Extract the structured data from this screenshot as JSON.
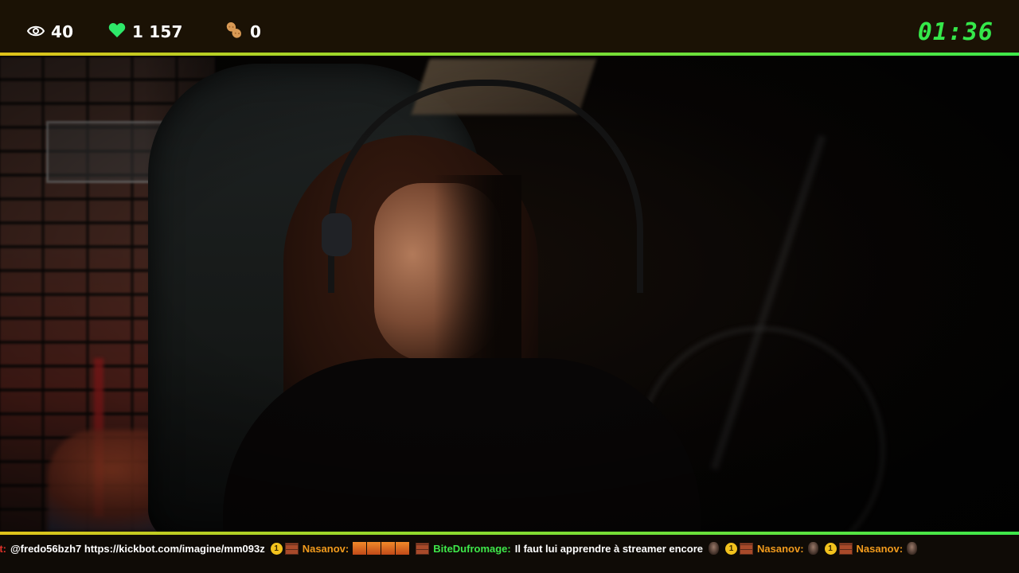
{
  "topbar": {
    "viewers": {
      "icon": "eye-icon",
      "value": "40"
    },
    "likes": {
      "icon": "heart-icon",
      "value": "1 157",
      "color": "#2ee86a"
    },
    "peanuts": {
      "icon": "peanut-icon",
      "value": "0"
    },
    "timer": "01:36",
    "accent_colors": [
      "#e0c21a",
      "#3ee84a"
    ]
  },
  "ticker": {
    "items": [
      {
        "user": "Bot:",
        "message": "@fredo56bzh7 https://kickbot.com/imagine/mm093z",
        "badges": [
          "coin-badge-1",
          "brick-badge"
        ]
      },
      {
        "user": "Nasanov:",
        "message": "",
        "emotes": 4,
        "badges": [
          "brick-badge"
        ]
      },
      {
        "user": "BiteDufromage:",
        "message": "Il faut lui apprendre à streamer encore",
        "badges": [
          "avatar-emote",
          "coin-badge-1",
          "brick-badge"
        ]
      },
      {
        "user": "Nasanov:",
        "message": "",
        "badges": [
          "avatar-emote",
          "coin-badge-1",
          "brick-badge"
        ]
      },
      {
        "user": "Nasanov:",
        "message": "",
        "badges": [
          "avatar-emote"
        ]
      }
    ],
    "coin_label": "1"
  }
}
